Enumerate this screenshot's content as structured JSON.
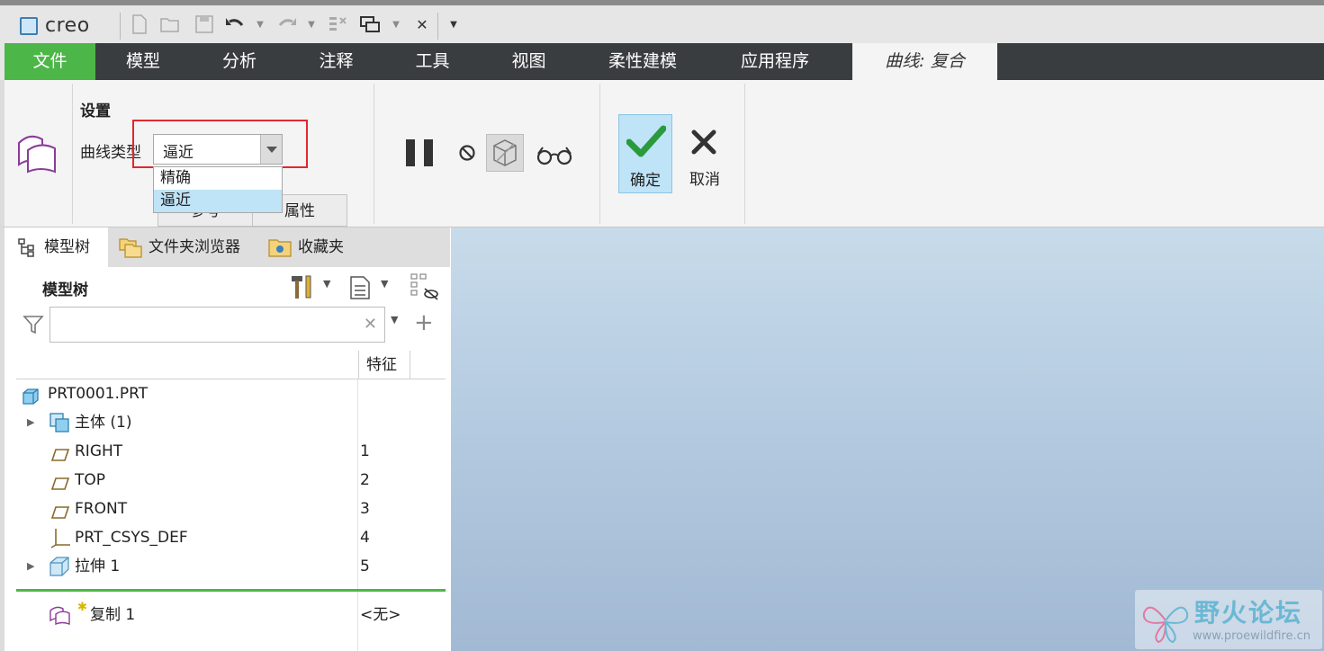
{
  "app": {
    "logo_text": "creo"
  },
  "tabs": {
    "file": "文件",
    "model": "模型",
    "analysis": "分析",
    "annotate": "注释",
    "tools": "工具",
    "view": "视图",
    "flexible": "柔性建模",
    "apps": "应用程序",
    "active": "曲线: 复合"
  },
  "ribbon": {
    "settings_title": "设置",
    "curve_type_label": "曲线类型",
    "curve_type_value": "逼近",
    "curve_type_options": [
      "精确",
      "逼近"
    ],
    "subtab_refs": "参考",
    "subtab_props": "属性",
    "ok_label": "确定",
    "cancel_label": "取消"
  },
  "navigator": {
    "tab_model_tree": "模型树",
    "tab_folder_browser": "文件夹浏览器",
    "tab_favorites": "收藏夹",
    "tree_title": "模型树",
    "search_placeholder": "",
    "col_feature": "特征",
    "rows": [
      {
        "label": "PRT0001.PRT",
        "num": ""
      },
      {
        "label": "主体 (1)",
        "num": ""
      },
      {
        "label": "RIGHT",
        "num": "1"
      },
      {
        "label": "TOP",
        "num": "2"
      },
      {
        "label": "FRONT",
        "num": "3"
      },
      {
        "label": "PRT_CSYS_DEF",
        "num": "4"
      },
      {
        "label": "拉伸 1",
        "num": "5"
      },
      {
        "label": "复制 1",
        "num": "<无>"
      }
    ]
  },
  "watermark": {
    "title": "野火论坛",
    "url": "www.proewildfire.cn"
  },
  "colors": {
    "file_tab": "#4cb648",
    "tab_bar": "#3a3d40",
    "selection": "#bfe3f7",
    "highlight_box": "#e0282e"
  }
}
